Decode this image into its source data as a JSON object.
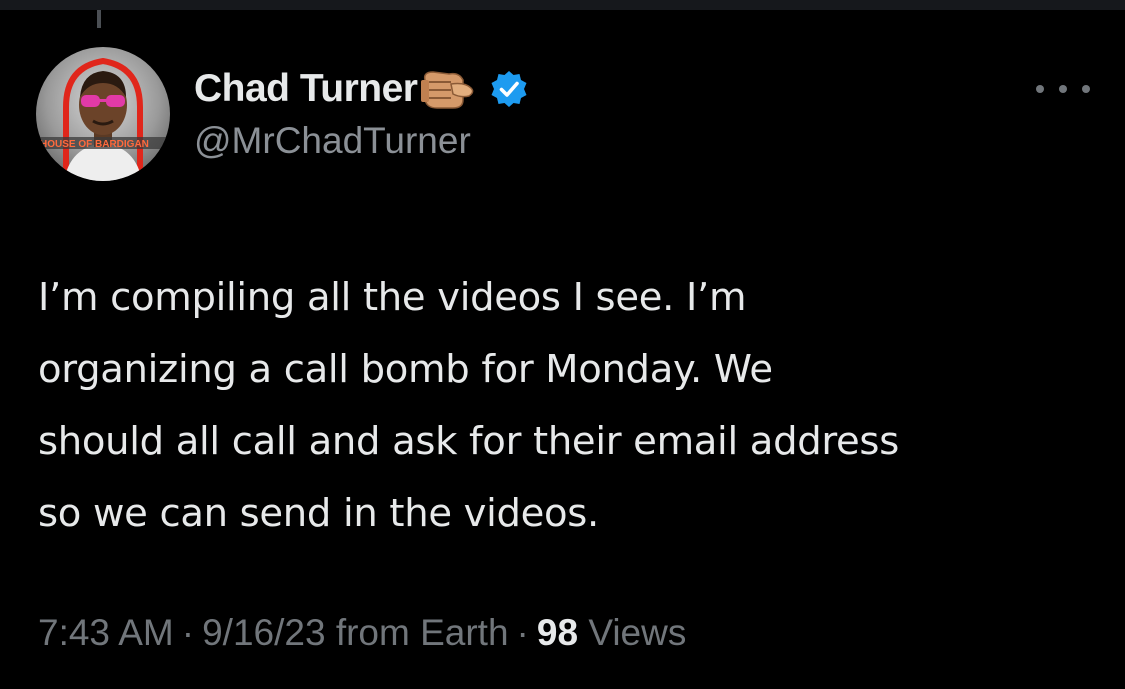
{
  "author": {
    "display_name": "Chad Turner",
    "handle": "@MrChadTurner",
    "name_emoji": "pointing-fist-emoji",
    "verified_icon": "verified-badge-icon",
    "verified_color": "#1d9bf0",
    "avatar_watermark": "HOUSE OF BARDIGAN"
  },
  "tweet": {
    "text": "I’m compiling all the videos I see. I’m\norganizing a call bomb for Monday. We\nshould all call and ask for their email address\nso we can send in the videos."
  },
  "meta": {
    "time": "7:43 AM",
    "separator": "·",
    "date_source": "9/16/23 from Earth",
    "views_count": "98",
    "views_label": "Views"
  },
  "actions": {
    "more_icon": "more-options-icon"
  },
  "colors": {
    "background": "#000000",
    "text_primary": "#e7e9ea",
    "text_secondary": "#71767b",
    "accent": "#1d9bf0"
  }
}
